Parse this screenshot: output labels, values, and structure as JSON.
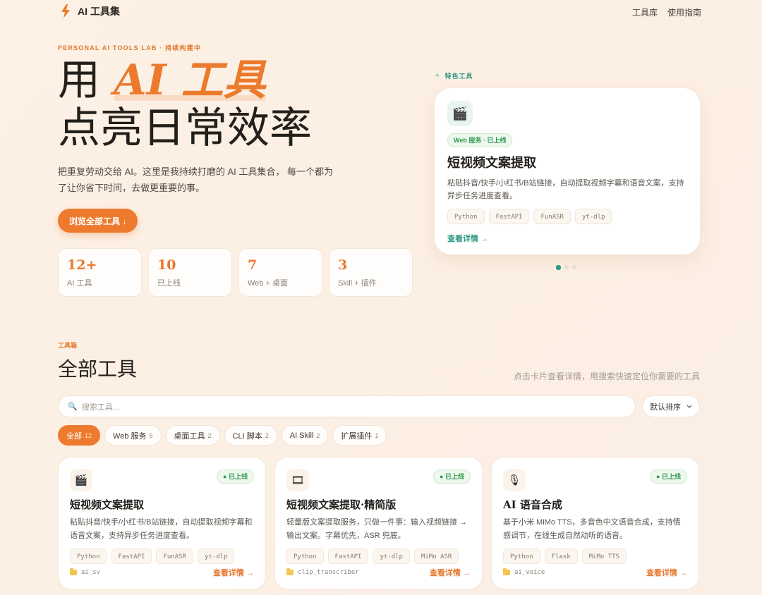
{
  "nav": {
    "brand": "AI 工具集",
    "links": [
      "工具库",
      "使用指南"
    ]
  },
  "hero": {
    "eyebrow": "PERSONAL AI TOOLS LAB · 持续构建中",
    "title_prefix": "用 ",
    "title_accent": "AI 工具",
    "title_line2": "点亮日常效率",
    "description": "把重复劳动交给 AI。这里是我持续打磨的 AI 工具集合， 每一个都为了让你省下时间，去做更重要的事。",
    "browse_button": "浏览全部工具 ↓",
    "stats": [
      {
        "num": "12+",
        "label": "AI 工具"
      },
      {
        "num": "10",
        "label": "已上线"
      },
      {
        "num": "7",
        "label": "Web + 桌面"
      },
      {
        "num": "3",
        "label": "Skill + 插件"
      }
    ]
  },
  "featured": {
    "label": "特色工具",
    "icon": "clapperboard-icon",
    "status": "Web 服务 · 已上线",
    "title": "短视频文案提取",
    "description": "粘贴抖音/快手/小红书/B站链接，自动提取视频字幕和语音文案，支持异步任务进度查看。",
    "tags": [
      "Python",
      "FastAPI",
      "FunASR",
      "yt-dlp"
    ],
    "link": "查看详情 →",
    "carousel_active": 0,
    "carousel_count": 3
  },
  "toolbox": {
    "eyebrow": "工具箱",
    "title": "全部工具",
    "subtitle": "点击卡片查看详情，用搜索快速定位你需要的工具",
    "search_placeholder": "搜索工具...",
    "sort_label": "默认排序",
    "filters": [
      {
        "label": "全部",
        "count": "12",
        "active": true
      },
      {
        "label": "Web 服务",
        "count": "5",
        "active": false
      },
      {
        "label": "桌面工具",
        "count": "2",
        "active": false
      },
      {
        "label": "CLI 脚本",
        "count": "2",
        "active": false
      },
      {
        "label": "AI Skill",
        "count": "2",
        "active": false
      },
      {
        "label": "扩展插件",
        "count": "1",
        "active": false
      }
    ],
    "cards": [
      {
        "icon": "clapperboard-icon",
        "status": "已上线",
        "title": "短视频文案提取",
        "description": "粘贴抖音/快手/小红书/B站链接，自动提取视频字幕和语音文案，支持异步任务进度查看。",
        "tags": [
          "Python",
          "FastAPI",
          "FunASR",
          "yt-dlp"
        ],
        "folder": "ai_sv",
        "link": "查看详情 →"
      },
      {
        "icon": "film-icon",
        "status": "已上线",
        "title": "短视频文案提取·精简版",
        "description": "轻量版文案提取服务，只做一件事：输入视频链接 → 输出文案。字幕优先，ASR 兜底。",
        "tags": [
          "Python",
          "FastAPI",
          "yt-dlp",
          "MiMo ASR"
        ],
        "folder": "clip_transcriber",
        "link": "查看详情 →"
      },
      {
        "icon": "microphone-icon",
        "status": "已上线",
        "title": "AI 语音合成",
        "description": "基于小米 MiMo TTS，多音色中文语音合成，支持情感调节，在线生成自然动听的语音。",
        "tags": [
          "Python",
          "Flask",
          "MiMo TTS"
        ],
        "folder": "ai_voice",
        "link": "查看详情 →"
      }
    ]
  },
  "colors": {
    "accent": "#ee7a2e",
    "teal": "#2f9a86",
    "green": "#2f9a50",
    "background": "#fdf1e5"
  }
}
